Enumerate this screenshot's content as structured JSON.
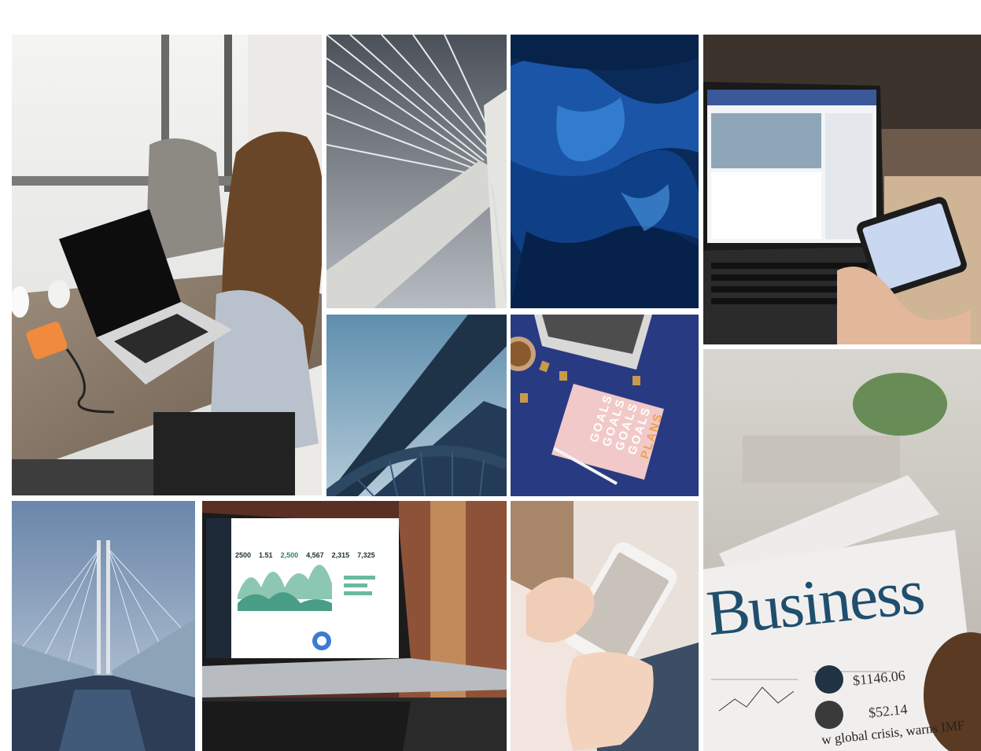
{
  "gallery": {
    "tiles": [
      {
        "id": "woman-laptop-window",
        "alt": "Woman working on laptop by a window"
      },
      {
        "id": "bridge-cables",
        "alt": "Cable-stayed bridge pylon from below"
      },
      {
        "id": "blue-fluid-art",
        "alt": "Abstract blue fluid art"
      },
      {
        "id": "laptop-phone",
        "alt": "Person holding phone in front of a laptop"
      },
      {
        "id": "steel-bridge",
        "alt": "Steel arch bridge against blue sky"
      },
      {
        "id": "goals-notebook",
        "alt": "Goals notebook on blue desk"
      },
      {
        "id": "newspaper-business",
        "alt": "Reading a business newspaper"
      },
      {
        "id": "footbridge-dusk",
        "alt": "Footbridge at dusk"
      },
      {
        "id": "laptop-analytics",
        "alt": "Laptop showing an analytics dashboard"
      },
      {
        "id": "phone-hands",
        "alt": "Hands holding a smartphone"
      }
    ]
  },
  "notebook": {
    "lines": [
      "GOALS",
      "GOALS",
      "GOALS",
      "GOALS",
      "PLANS"
    ]
  },
  "newspaper": {
    "headline": "Business",
    "price_1": "$1146.06",
    "price_2": "$52.14",
    "footer_line": "w global crisis, warns IMF"
  },
  "dashboard": {
    "stats": [
      "2500",
      "1.51",
      "2,500",
      "4,567",
      "2,315",
      "7,325"
    ]
  },
  "colors": {
    "page_bg": "#ffffff",
    "goals_pink": "#f1c9c8",
    "plans_orange": "#f0a24b",
    "desk_blue": "#283a82",
    "newsprint_blue": "#1f4e6e"
  }
}
